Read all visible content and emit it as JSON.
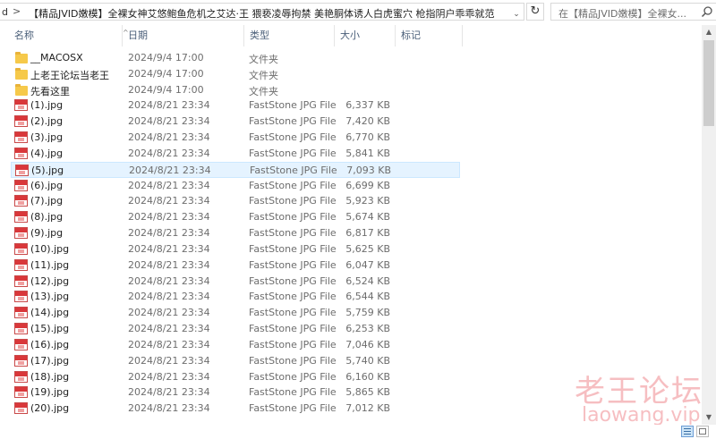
{
  "address_bar": {
    "left_fragment": "d",
    "separator": ">",
    "path": "【精品JVID嫩模】全裸女神艾悠鲍鱼危机之艾达·王 猥亵凌辱拘禁 美艳胴体诱人白虎蜜穴 枪指阴户乖乖就范",
    "dropdown": "⌄",
    "refresh": "↻"
  },
  "search": {
    "placeholder": "在【精品JVID嫩模】全裸女..."
  },
  "columns": {
    "name": "名称",
    "date": "日期",
    "type": "类型",
    "size": "大小",
    "tags": "标记",
    "sort_indicator": "^"
  },
  "rows": [
    {
      "name": "__MACOSX",
      "date": "2024/9/4 17:00",
      "type": "文件夹",
      "size": "",
      "icon": "folder-icon"
    },
    {
      "name": "上老王论坛当老王",
      "date": "2024/9/4 17:00",
      "type": "文件夹",
      "size": "",
      "icon": "folder-icon"
    },
    {
      "name": "先看这里",
      "date": "2024/9/4 17:00",
      "type": "文件夹",
      "size": "",
      "icon": "folder-icon"
    },
    {
      "name": "(1).jpg",
      "date": "2024/8/21 23:34",
      "type": "FastStone JPG File",
      "size": "6,337 KB",
      "icon": "jpg-file-icon"
    },
    {
      "name": "(2).jpg",
      "date": "2024/8/21 23:34",
      "type": "FastStone JPG File",
      "size": "7,420 KB",
      "icon": "jpg-file-icon"
    },
    {
      "name": "(3).jpg",
      "date": "2024/8/21 23:34",
      "type": "FastStone JPG File",
      "size": "6,770 KB",
      "icon": "jpg-file-icon"
    },
    {
      "name": "(4).jpg",
      "date": "2024/8/21 23:34",
      "type": "FastStone JPG File",
      "size": "5,841 KB",
      "icon": "jpg-file-icon"
    },
    {
      "name": "(5).jpg",
      "date": "2024/8/21 23:34",
      "type": "FastStone JPG File",
      "size": "7,093 KB",
      "icon": "jpg-file-icon",
      "selected": true
    },
    {
      "name": "(6).jpg",
      "date": "2024/8/21 23:34",
      "type": "FastStone JPG File",
      "size": "6,699 KB",
      "icon": "jpg-file-icon"
    },
    {
      "name": "(7).jpg",
      "date": "2024/8/21 23:34",
      "type": "FastStone JPG File",
      "size": "5,923 KB",
      "icon": "jpg-file-icon"
    },
    {
      "name": "(8).jpg",
      "date": "2024/8/21 23:34",
      "type": "FastStone JPG File",
      "size": "5,674 KB",
      "icon": "jpg-file-icon"
    },
    {
      "name": "(9).jpg",
      "date": "2024/8/21 23:34",
      "type": "FastStone JPG File",
      "size": "6,817 KB",
      "icon": "jpg-file-icon"
    },
    {
      "name": "(10).jpg",
      "date": "2024/8/21 23:34",
      "type": "FastStone JPG File",
      "size": "5,625 KB",
      "icon": "jpg-file-icon"
    },
    {
      "name": "(11).jpg",
      "date": "2024/8/21 23:34",
      "type": "FastStone JPG File",
      "size": "6,047 KB",
      "icon": "jpg-file-icon"
    },
    {
      "name": "(12).jpg",
      "date": "2024/8/21 23:34",
      "type": "FastStone JPG File",
      "size": "6,524 KB",
      "icon": "jpg-file-icon"
    },
    {
      "name": "(13).jpg",
      "date": "2024/8/21 23:34",
      "type": "FastStone JPG File",
      "size": "6,544 KB",
      "icon": "jpg-file-icon"
    },
    {
      "name": "(14).jpg",
      "date": "2024/8/21 23:34",
      "type": "FastStone JPG File",
      "size": "5,759 KB",
      "icon": "jpg-file-icon"
    },
    {
      "name": "(15).jpg",
      "date": "2024/8/21 23:34",
      "type": "FastStone JPG File",
      "size": "6,253 KB",
      "icon": "jpg-file-icon"
    },
    {
      "name": "(16).jpg",
      "date": "2024/8/21 23:34",
      "type": "FastStone JPG File",
      "size": "7,046 KB",
      "icon": "jpg-file-icon"
    },
    {
      "name": "(17).jpg",
      "date": "2024/8/21 23:34",
      "type": "FastStone JPG File",
      "size": "5,740 KB",
      "icon": "jpg-file-icon"
    },
    {
      "name": "(18).jpg",
      "date": "2024/8/21 23:34",
      "type": "FastStone JPG File",
      "size": "6,160 KB",
      "icon": "jpg-file-icon"
    },
    {
      "name": "(19).jpg",
      "date": "2024/8/21 23:34",
      "type": "FastStone JPG File",
      "size": "5,865 KB",
      "icon": "jpg-file-icon"
    },
    {
      "name": "(20).jpg",
      "date": "2024/8/21 23:34",
      "type": "FastStone JPG File",
      "size": "7,012 KB",
      "icon": "jpg-file-icon"
    }
  ],
  "watermark": {
    "cn": "老王论坛",
    "en": "laowang.vip"
  },
  "colors": {
    "selection": "#e5f3ff",
    "header_text": "#4c607a",
    "watermark": "#f08a90"
  }
}
